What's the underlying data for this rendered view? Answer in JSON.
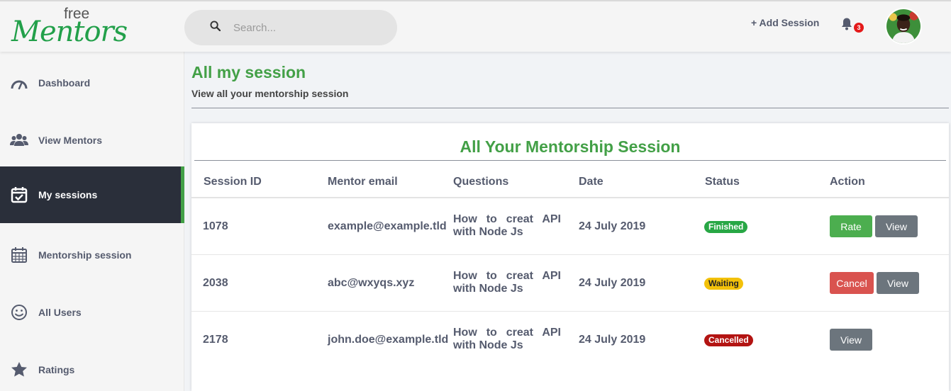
{
  "header": {
    "logo_top": "free",
    "logo_main": "Mentors",
    "search_placeholder": "Search...",
    "add_session": "+ Add Session",
    "notification_count": "3"
  },
  "sidebar": {
    "items": [
      {
        "label": "Dashboard",
        "icon": "gauge-icon"
      },
      {
        "label": "View Mentors",
        "icon": "users-icon"
      },
      {
        "label": "My sessions",
        "icon": "calendar-check-icon"
      },
      {
        "label": "Mentorship session",
        "icon": "calendar-icon"
      },
      {
        "label": "All Users",
        "icon": "smile-icon"
      },
      {
        "label": "Ratings",
        "icon": "star-icon"
      }
    ],
    "active_index": 2
  },
  "page": {
    "title": "All my session",
    "subtitle": "View all your mentorship session"
  },
  "table": {
    "title": "All Your Mentorship Session",
    "columns": [
      "Session ID",
      "Mentor email",
      "Questions",
      "Date",
      "Status",
      "Action"
    ],
    "rows": [
      {
        "id": "1078",
        "email": "example@example.tld",
        "question": "How to creat API with Node Js",
        "date": "24 July 2019",
        "status": "Finished",
        "actions": [
          "Rate",
          "View"
        ]
      },
      {
        "id": "2038",
        "email": "abc@wxyqs.xyz",
        "question": "How to creat API with Node Js",
        "date": "24 July 2019",
        "status": "Waiting",
        "actions": [
          "Cancel",
          "View"
        ]
      },
      {
        "id": "2178",
        "email": "john.doe@example.tld",
        "question": "How to creat API with Node Js",
        "date": "24 July 2019",
        "status": "Cancelled",
        "actions": [
          "View"
        ]
      }
    ]
  },
  "colors": {
    "brand_green": "#43a047",
    "sidebar_active_bg": "#2a2f3a",
    "finished": "#28a745",
    "waiting": "#f3c10a",
    "cancelled": "#b31412",
    "rate_button": "#4cae4f",
    "cancel_button": "#d9534f",
    "view_button": "#6c757d"
  }
}
